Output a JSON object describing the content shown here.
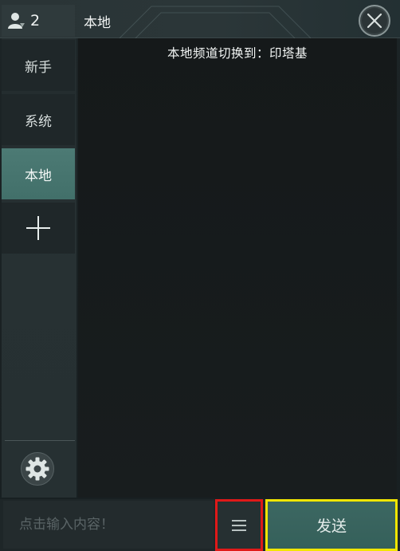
{
  "header": {
    "online_count": "2",
    "channel_title": "本地"
  },
  "channels": [
    {
      "label": "新手",
      "active": false
    },
    {
      "label": "系统",
      "active": false
    },
    {
      "label": "本地",
      "active": true
    }
  ],
  "messages": {
    "system_notice": "本地频道切换到：印塔基"
  },
  "composer": {
    "placeholder": "点击输入内容！",
    "send_label": "发送"
  },
  "icons": {
    "online_users": "person-icon",
    "close": "close-icon",
    "add_channel": "plus-icon",
    "settings": "gear-icon",
    "menu": "hamburger-menu-icon"
  },
  "colors": {
    "active_tab": "#4c7a74",
    "send_button": "#3c6762",
    "highlight_red": "#e01919",
    "highlight_yellow": "#f2e600"
  }
}
